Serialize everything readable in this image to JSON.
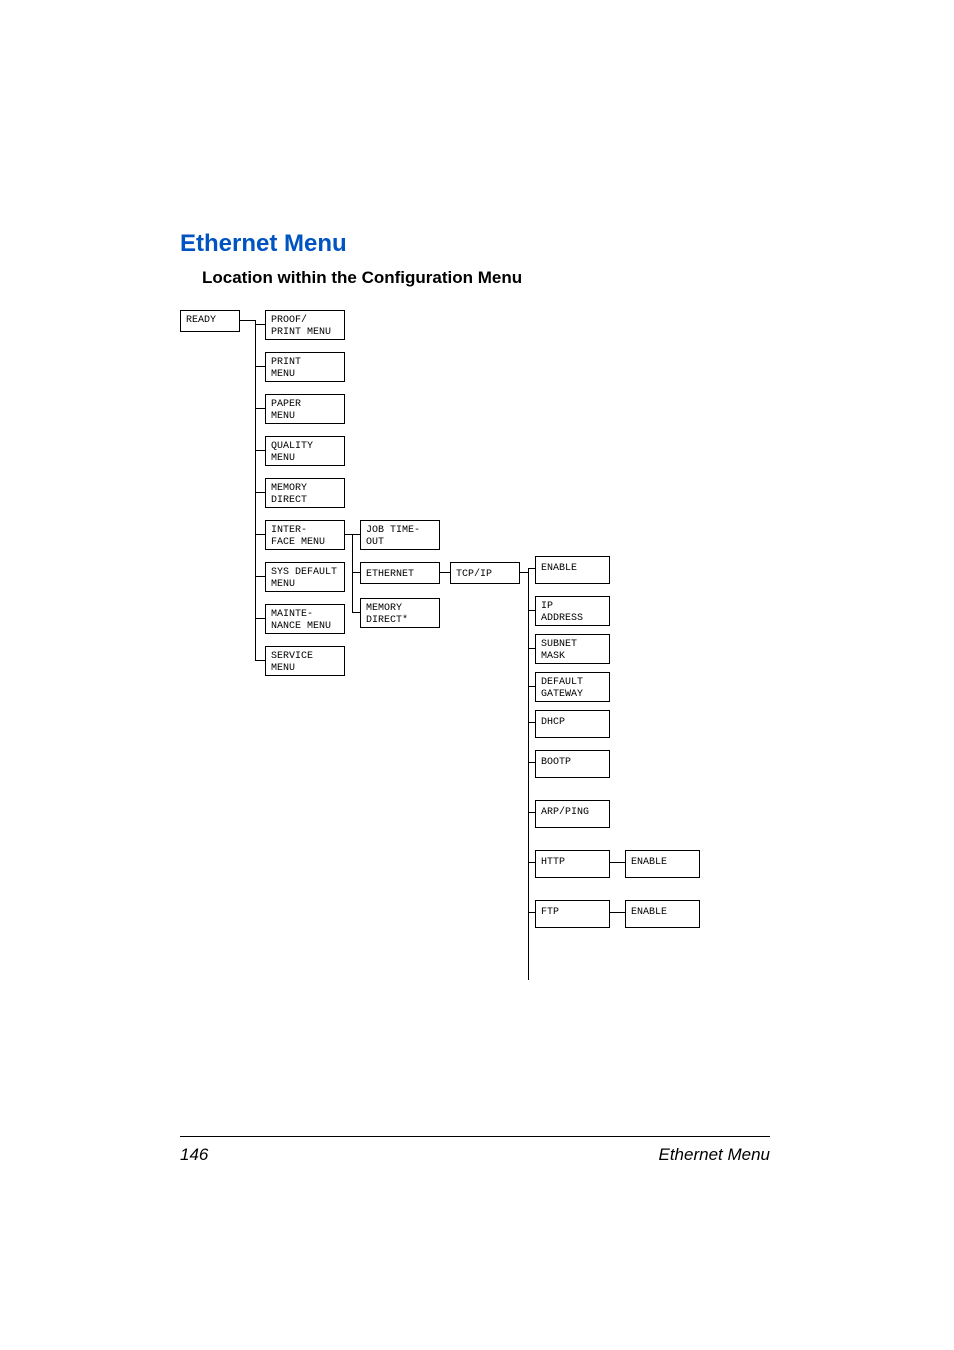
{
  "heading": "Ethernet Menu",
  "subheading": "Location within the Configuration Menu",
  "footer": {
    "page": "146",
    "section": "Ethernet Menu"
  },
  "nodes": {
    "ready": "READY",
    "proof": "PROOF/\nPRINT MENU",
    "print": "PRINT\nMENU",
    "paper": "PAPER\nMENU",
    "quality": "QUALITY\nMENU",
    "memdir": "MEMORY\nDIRECT",
    "interface": "INTER-\nFACE MENU",
    "sysdef": "SYS DEFAULT\nMENU",
    "mainte": "MAINTE-\nNANCE MENU",
    "service": "SERVICE\nMENU",
    "jobtime": "JOB TIME-\nOUT",
    "ethernet": "ETHERNET",
    "memdir2": "MEMORY\nDIRECT*",
    "tcpip": "TCP/IP",
    "enable1": "ENABLE",
    "ipaddr": "IP\nADDRESS",
    "subnet": "SUBNET\nMASK",
    "gateway": "DEFAULT\nGATEWAY",
    "dhcp": "DHCP",
    "bootp": "BOOTP",
    "arpping": "ARP/PING",
    "http": "HTTP",
    "ftp": "FTP",
    "enable2": "ENABLE",
    "enable3": "ENABLE"
  }
}
